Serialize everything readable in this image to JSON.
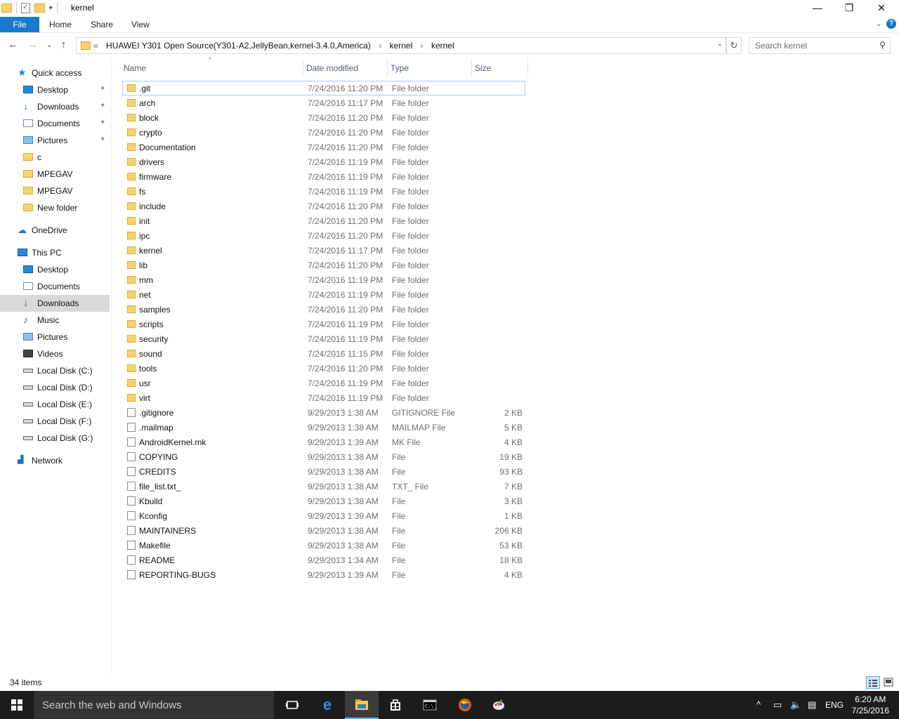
{
  "window": {
    "title": "kernel",
    "minimize_icon": "minimize-icon",
    "maximize_icon": "restore-icon",
    "close_icon": "close-icon"
  },
  "ribbon": {
    "tabs": [
      "File",
      "Home",
      "Share",
      "View"
    ]
  },
  "address_bar": {
    "overflow": "«",
    "segments": [
      "HUAWEI Y301 Open Source(Y301-A2,JellyBean,kernel-3.4.0,America)",
      "kernel",
      "kernel"
    ],
    "separator": "›"
  },
  "search": {
    "placeholder": "Search kernel"
  },
  "nav_pane": {
    "items": [
      {
        "label": "Quick access",
        "icon": "star-icon"
      },
      {
        "label": "Desktop",
        "icon": "desktop-icon",
        "pinned": true
      },
      {
        "label": "Downloads",
        "icon": "downloads-icon",
        "pinned": true
      },
      {
        "label": "Documents",
        "icon": "documents-icon",
        "pinned": true
      },
      {
        "label": "Pictures",
        "icon": "pictures-icon",
        "pinned": true
      },
      {
        "label": "c",
        "icon": "folder-icon"
      },
      {
        "label": "MPEGAV",
        "icon": "folder-icon"
      },
      {
        "label": "MPEGAV",
        "icon": "folder-icon"
      },
      {
        "label": "New folder",
        "icon": "folder-icon"
      },
      {
        "label": "OneDrive",
        "icon": "onedrive-icon"
      },
      {
        "label": "This PC",
        "icon": "computer-icon"
      },
      {
        "label": "Desktop",
        "icon": "desktop-icon"
      },
      {
        "label": "Documents",
        "icon": "documents-icon"
      },
      {
        "label": "Downloads",
        "icon": "downloads-icon",
        "selected": true
      },
      {
        "label": "Music",
        "icon": "music-icon"
      },
      {
        "label": "Pictures",
        "icon": "pictures-icon"
      },
      {
        "label": "Videos",
        "icon": "videos-icon"
      },
      {
        "label": "Local Disk (C:)",
        "icon": "drive-icon"
      },
      {
        "label": "Local Disk (D:)",
        "icon": "drive-icon"
      },
      {
        "label": "Local Disk (E:)",
        "icon": "drive-icon"
      },
      {
        "label": "Local Disk (F:)",
        "icon": "drive-icon"
      },
      {
        "label": "Local Disk (G:)",
        "icon": "drive-icon"
      },
      {
        "label": "Network",
        "icon": "network-icon"
      }
    ]
  },
  "file_list": {
    "columns": [
      "Name",
      "Date modified",
      "Type",
      "Size"
    ],
    "rows": [
      {
        "name": ".git",
        "date": "7/24/2016 11:20 PM",
        "type": "File folder",
        "size": "",
        "kind": "folder"
      },
      {
        "name": "arch",
        "date": "7/24/2016 11:17 PM",
        "type": "File folder",
        "size": "",
        "kind": "folder"
      },
      {
        "name": "block",
        "date": "7/24/2016 11:20 PM",
        "type": "File folder",
        "size": "",
        "kind": "folder"
      },
      {
        "name": "crypto",
        "date": "7/24/2016 11:20 PM",
        "type": "File folder",
        "size": "",
        "kind": "folder"
      },
      {
        "name": "Documentation",
        "date": "7/24/2016 11:20 PM",
        "type": "File folder",
        "size": "",
        "kind": "folder"
      },
      {
        "name": "drivers",
        "date": "7/24/2016 11:19 PM",
        "type": "File folder",
        "size": "",
        "kind": "folder"
      },
      {
        "name": "firmware",
        "date": "7/24/2016 11:19 PM",
        "type": "File folder",
        "size": "",
        "kind": "folder"
      },
      {
        "name": "fs",
        "date": "7/24/2016 11:19 PM",
        "type": "File folder",
        "size": "",
        "kind": "folder"
      },
      {
        "name": "include",
        "date": "7/24/2016 11:20 PM",
        "type": "File folder",
        "size": "",
        "kind": "folder"
      },
      {
        "name": "init",
        "date": "7/24/2016 11:20 PM",
        "type": "File folder",
        "size": "",
        "kind": "folder"
      },
      {
        "name": "ipc",
        "date": "7/24/2016 11:20 PM",
        "type": "File folder",
        "size": "",
        "kind": "folder"
      },
      {
        "name": "kernel",
        "date": "7/24/2016 11:17 PM",
        "type": "File folder",
        "size": "",
        "kind": "folder"
      },
      {
        "name": "lib",
        "date": "7/24/2016 11:20 PM",
        "type": "File folder",
        "size": "",
        "kind": "folder"
      },
      {
        "name": "mm",
        "date": "7/24/2016 11:19 PM",
        "type": "File folder",
        "size": "",
        "kind": "folder"
      },
      {
        "name": "net",
        "date": "7/24/2016 11:19 PM",
        "type": "File folder",
        "size": "",
        "kind": "folder"
      },
      {
        "name": "samples",
        "date": "7/24/2016 11:20 PM",
        "type": "File folder",
        "size": "",
        "kind": "folder"
      },
      {
        "name": "scripts",
        "date": "7/24/2016 11:19 PM",
        "type": "File folder",
        "size": "",
        "kind": "folder"
      },
      {
        "name": "security",
        "date": "7/24/2016 11:19 PM",
        "type": "File folder",
        "size": "",
        "kind": "folder"
      },
      {
        "name": "sound",
        "date": "7/24/2016 11:15 PM",
        "type": "File folder",
        "size": "",
        "kind": "folder"
      },
      {
        "name": "tools",
        "date": "7/24/2016 11:20 PM",
        "type": "File folder",
        "size": "",
        "kind": "folder"
      },
      {
        "name": "usr",
        "date": "7/24/2016 11:19 PM",
        "type": "File folder",
        "size": "",
        "kind": "folder"
      },
      {
        "name": "virt",
        "date": "7/24/2016 11:19 PM",
        "type": "File folder",
        "size": "",
        "kind": "folder"
      },
      {
        "name": ".gitignore",
        "date": "9/29/2013 1:38 AM",
        "type": "GITIGNORE File",
        "size": "2 KB",
        "kind": "file"
      },
      {
        "name": ".mailmap",
        "date": "9/29/2013 1:38 AM",
        "type": "MAILMAP File",
        "size": "5 KB",
        "kind": "file"
      },
      {
        "name": "AndroidKernel.mk",
        "date": "9/29/2013 1:39 AM",
        "type": "MK File",
        "size": "4 KB",
        "kind": "file"
      },
      {
        "name": "COPYING",
        "date": "9/29/2013 1:38 AM",
        "type": "File",
        "size": "19 KB",
        "kind": "file"
      },
      {
        "name": "CREDITS",
        "date": "9/29/2013 1:38 AM",
        "type": "File",
        "size": "93 KB",
        "kind": "file"
      },
      {
        "name": "file_list.txt_",
        "date": "9/29/2013 1:38 AM",
        "type": "TXT_ File",
        "size": "7 KB",
        "kind": "file"
      },
      {
        "name": "Kbuild",
        "date": "9/29/2013 1:38 AM",
        "type": "File",
        "size": "3 KB",
        "kind": "file"
      },
      {
        "name": "Kconfig",
        "date": "9/29/2013 1:39 AM",
        "type": "File",
        "size": "1 KB",
        "kind": "file"
      },
      {
        "name": "MAINTAINERS",
        "date": "9/29/2013 1:38 AM",
        "type": "File",
        "size": "206 KB",
        "kind": "file"
      },
      {
        "name": "Makefile",
        "date": "9/29/2013 1:38 AM",
        "type": "File",
        "size": "53 KB",
        "kind": "file"
      },
      {
        "name": "README",
        "date": "9/29/2013 1:34 AM",
        "type": "File",
        "size": "18 KB",
        "kind": "file"
      },
      {
        "name": "REPORTING-BUGS",
        "date": "9/29/2013 1:39 AM",
        "type": "File",
        "size": "4 KB",
        "kind": "file"
      }
    ]
  },
  "status_bar": {
    "item_count": "34 items"
  },
  "taskbar": {
    "search_placeholder": "Search the web and Windows",
    "apps": [
      "task-view-icon",
      "edge-icon",
      "file-explorer-icon",
      "store-icon",
      "command-prompt-icon",
      "firefox-icon",
      "paint-icon"
    ],
    "language": "ENG",
    "time": "6:20 AM",
    "date": "7/25/2016"
  },
  "colors": {
    "accent": "#1979ca",
    "selection": "#cce8ff",
    "folder": "#f7d36b",
    "taskbar": "#1c1c1c"
  }
}
